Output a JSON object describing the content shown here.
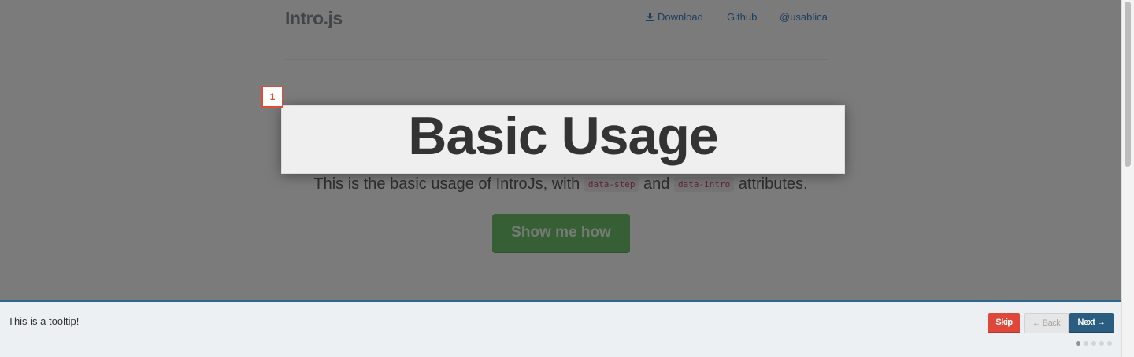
{
  "header": {
    "brand": "Intro.js",
    "nav": [
      {
        "label": "Download",
        "icon": "download-icon"
      },
      {
        "label": "Github"
      },
      {
        "label": "@usablica"
      }
    ]
  },
  "hero": {
    "title": "Basic Usage",
    "subtitle_before": "This is the basic usage of IntroJs, with",
    "code_step": "data-step",
    "subtitle_and": "and",
    "code_intro": "data-intro",
    "subtitle_after": "attributes.",
    "cta_label": "Show me how"
  },
  "intro": {
    "step_number": "1",
    "tooltip_text": "This is a tooltip!",
    "skip_label": "Skip",
    "back_label": "← Back",
    "next_label": "Next →",
    "total_steps": 5,
    "current_step": 1
  },
  "colors": {
    "accent": "#2e6690",
    "skip": "#e0473b",
    "cta": "#6cbf6c"
  }
}
